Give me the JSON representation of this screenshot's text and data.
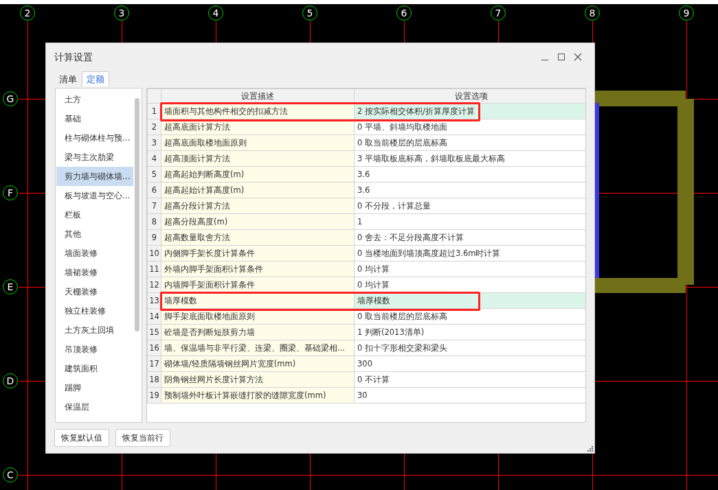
{
  "canvas": {
    "column_axes": [
      "2",
      "3",
      "4",
      "5",
      "6",
      "7",
      "8",
      "9"
    ],
    "row_axes": [
      "G",
      "F",
      "E",
      "D",
      "C"
    ]
  },
  "dialog": {
    "title": "计算设置",
    "tabs": [
      {
        "label": "清单",
        "selected": false
      },
      {
        "label": "定额",
        "selected": true
      }
    ],
    "categories": [
      {
        "label": "土方",
        "selected": false
      },
      {
        "label": "基础",
        "selected": false
      },
      {
        "label": "柱与砌体柱与预...",
        "selected": false
      },
      {
        "label": "梁与主次肋梁",
        "selected": false
      },
      {
        "label": "剪力墙与砌体墙...",
        "selected": true
      },
      {
        "label": "板与坡道与空心...",
        "selected": false
      },
      {
        "label": "栏板",
        "selected": false
      },
      {
        "label": "其他",
        "selected": false
      },
      {
        "label": "墙面装修",
        "selected": false
      },
      {
        "label": "墙裙装修",
        "selected": false
      },
      {
        "label": "天棚装修",
        "selected": false
      },
      {
        "label": "独立柱装修",
        "selected": false
      },
      {
        "label": "土方灰土回填",
        "selected": false
      },
      {
        "label": "吊顶装修",
        "selected": false
      },
      {
        "label": "建筑面积",
        "selected": false
      },
      {
        "label": "踢脚",
        "selected": false
      },
      {
        "label": "保温层",
        "selected": false
      }
    ],
    "table": {
      "columns": [
        "设置描述",
        "设置选项"
      ],
      "rows": [
        {
          "index": "1",
          "description": "墙面积与其他构件相交的扣减方法",
          "option": "2 按实际相交体积/折算厚度计算",
          "modified": true,
          "annotated": true
        },
        {
          "index": "2",
          "description": "超高底面计算方法",
          "option": "0 平墙、斜墙均取楼地面",
          "modified": false,
          "annotated": false
        },
        {
          "index": "3",
          "description": "超高底面取楼地面原则",
          "option": "0 取当前楼层的层底标高",
          "modified": false,
          "annotated": false
        },
        {
          "index": "4",
          "description": "超高顶面计算方法",
          "option": "3 平墙取板底标高，斜墙取板底最大标高",
          "modified": false,
          "annotated": false
        },
        {
          "index": "5",
          "description": "超高起始判断高度(m)",
          "option": "3.6",
          "modified": false,
          "annotated": false
        },
        {
          "index": "6",
          "description": "超高起始计算高度(m)",
          "option": "3.6",
          "modified": false,
          "annotated": false
        },
        {
          "index": "7",
          "description": "超高分段计算方法",
          "option": "0 不分段，计算总量",
          "modified": false,
          "annotated": false
        },
        {
          "index": "8",
          "description": "超高分段高度(m)",
          "option": "1",
          "modified": false,
          "annotated": false
        },
        {
          "index": "9",
          "description": "超高数量取舍方法",
          "option": "0 舍去：不足分段高度不计算",
          "modified": false,
          "annotated": false
        },
        {
          "index": "10",
          "description": "内侧脚手架长度计算条件",
          "option": "0 当楼地面到墙顶高度超过3.6m时计算",
          "modified": false,
          "annotated": false
        },
        {
          "index": "11",
          "description": "外墙内脚手架面积计算条件",
          "option": "0 均计算",
          "modified": false,
          "annotated": false
        },
        {
          "index": "12",
          "description": "内墙脚手架面积计算条件",
          "option": "0 均计算",
          "modified": false,
          "annotated": false
        },
        {
          "index": "13",
          "description": "墙厚模数",
          "option": "墙厚模数",
          "modified": true,
          "annotated": true
        },
        {
          "index": "14",
          "description": "脚手架底面取楼地面原则",
          "option": "0 取当前楼层的层底标高",
          "modified": false,
          "annotated": false
        },
        {
          "index": "15",
          "description": "砼墙是否判断短肢剪力墙",
          "option": "1 判断(2013清单)",
          "modified": false,
          "annotated": false
        },
        {
          "index": "16",
          "description": "墙、保温墙与非平行梁、连梁、圈梁、基础梁相...",
          "option": "0 扣十字形相交梁和梁头",
          "modified": false,
          "annotated": false
        },
        {
          "index": "17",
          "description": "砌体墙/轻质隔墙钢丝网片宽度(mm)",
          "option": "300",
          "modified": false,
          "annotated": false
        },
        {
          "index": "18",
          "description": "阴角钢丝网片长度计算方法",
          "option": "0 不计算",
          "modified": false,
          "annotated": false
        },
        {
          "index": "19",
          "description": "预制墙外叶板计算嵌缝打胶的缝隙宽度(mm)",
          "option": "30",
          "modified": false,
          "annotated": false
        }
      ]
    },
    "buttons": [
      "恢复默认值",
      "恢复当前行"
    ]
  }
}
